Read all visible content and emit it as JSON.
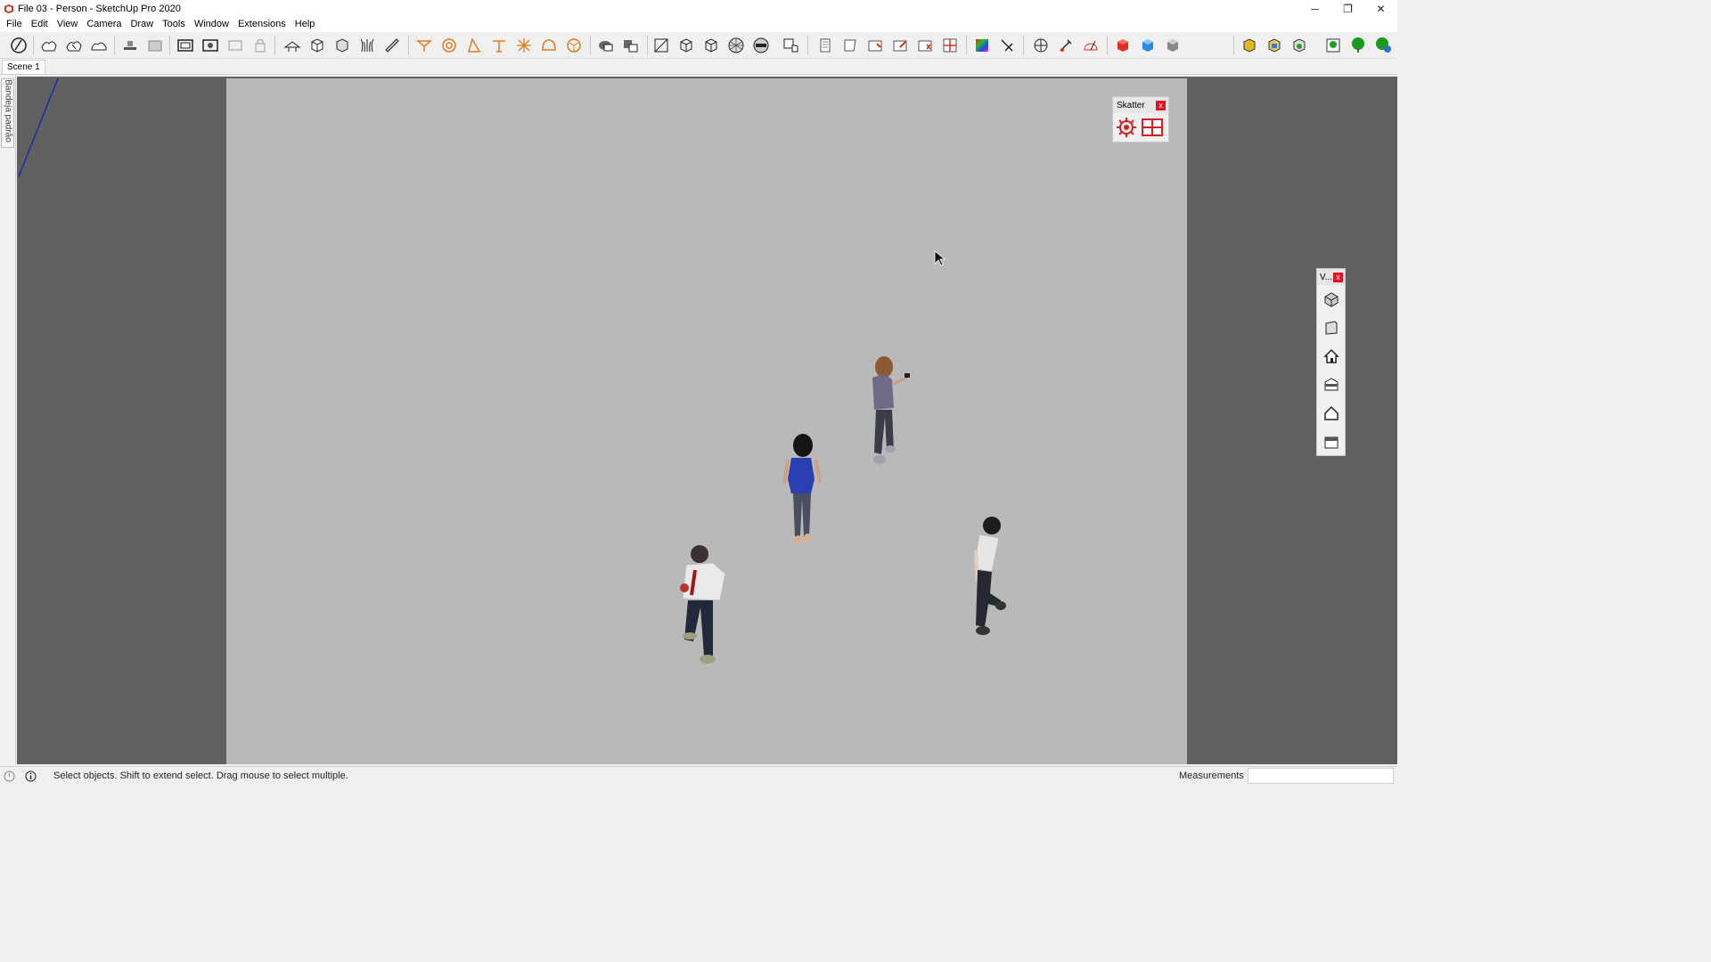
{
  "window": {
    "title": "File 03 - Person - SketchUp Pro 2020",
    "controls": {
      "minimize": "─",
      "restore": "❐",
      "close": "✕"
    }
  },
  "menubar": {
    "items": [
      "File",
      "Edit",
      "View",
      "Camera",
      "Draw",
      "Tools",
      "Window",
      "Extensions",
      "Help"
    ]
  },
  "scenes": {
    "tabs": [
      "Scene 1"
    ]
  },
  "tray": {
    "label": "Bandeja padrão"
  },
  "panels": {
    "skatter": {
      "title": "Skatter",
      "close": "x"
    },
    "views": {
      "title": "V...",
      "close": "x"
    }
  },
  "status": {
    "message": "Select objects. Shift to extend select. Drag mouse to select multiple.",
    "measurements_label": "Measurements",
    "measurements_value": ""
  },
  "colors": {
    "viewport_bg": "#606060",
    "scene_bg": "#b9b9b9",
    "toolbar_orange": "#e07a1f",
    "axis_blue": "#1a2aa8"
  }
}
